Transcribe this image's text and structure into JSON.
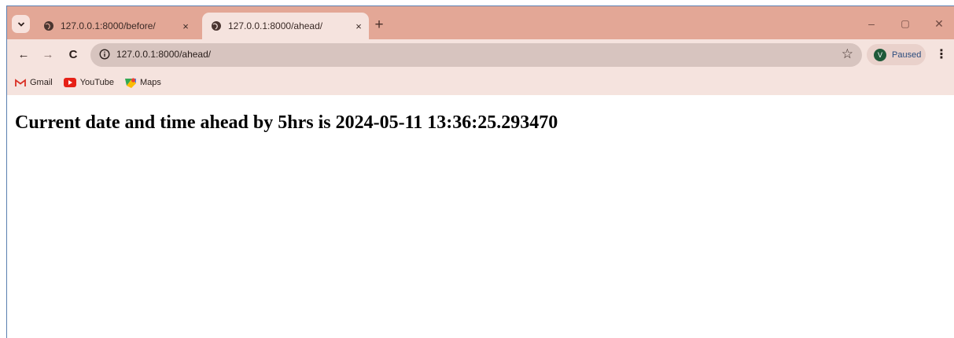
{
  "tabs": [
    {
      "title": "127.0.0.1:8000/before/",
      "close": "×",
      "active": false
    },
    {
      "title": "127.0.0.1:8000/ahead/",
      "close": "×",
      "active": true
    }
  ],
  "new_tab": "+",
  "window_controls": {
    "minimize": "–",
    "restore": "▢",
    "close": "✕"
  },
  "toolbar": {
    "back": "←",
    "forward": "→",
    "reload": "C",
    "url": "127.0.0.1:8000/ahead/",
    "bookmark_star": "☆",
    "profile_initial": "V",
    "profile_status": "Paused",
    "menu": "⋮"
  },
  "bookmarks": [
    {
      "label": "Gmail",
      "icon": "gmail-icon"
    },
    {
      "label": "YouTube",
      "icon": "youtube-icon"
    },
    {
      "label": "Maps",
      "icon": "maps-icon"
    }
  ],
  "page": {
    "heading": "Current date and time ahead by 5hrs is 2024-05-11 13:36:25.293470"
  },
  "colors": {
    "tabstrip": "#e3a796",
    "toolbar": "#f5e3de",
    "omnibox": "#d7c4bf",
    "profile_avatar": "#1f5a3a"
  }
}
